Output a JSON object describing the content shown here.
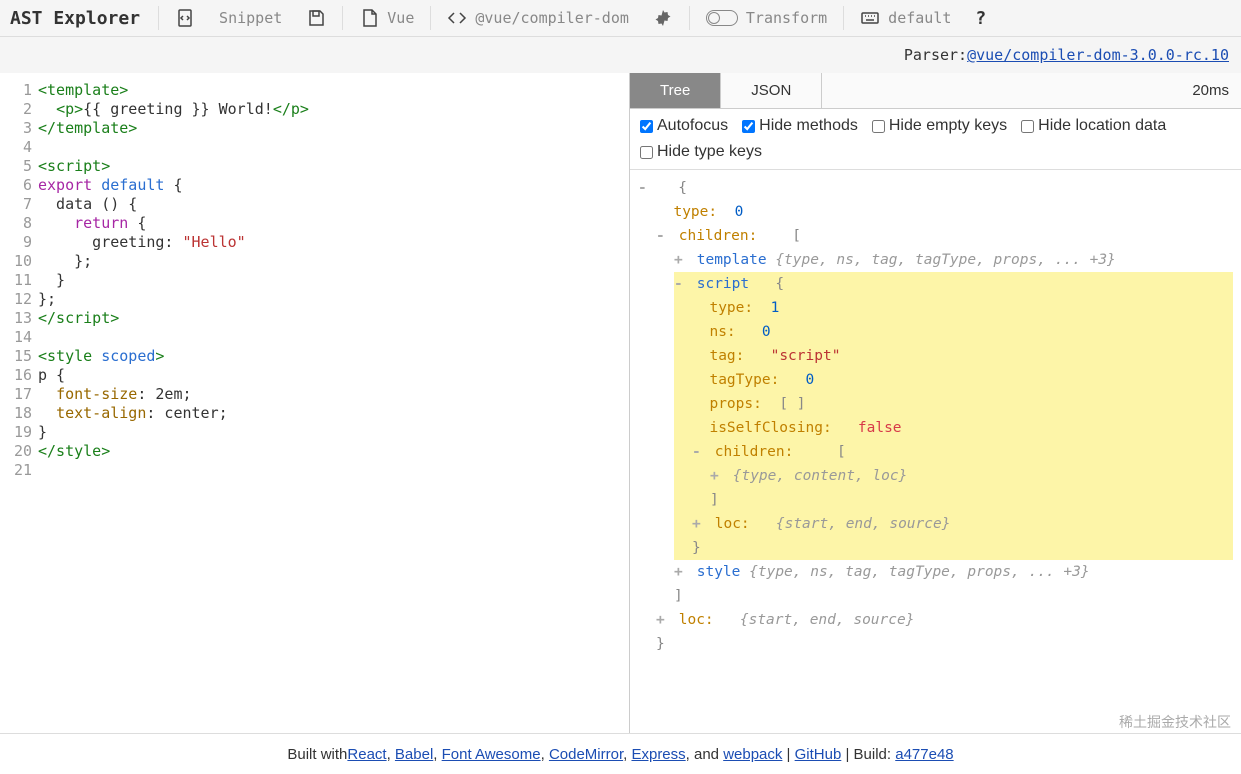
{
  "header": {
    "logo": "AST Explorer",
    "snippet": "Snippet",
    "lang": "Vue",
    "parser": "@vue/compiler-dom",
    "transform": "Transform",
    "keymap": "default",
    "help": "?"
  },
  "parser_bar": {
    "label": "Parser: ",
    "link": "@vue/compiler-dom-3.0.0-rc.10"
  },
  "editor": {
    "lines": [
      {
        "segs": [
          {
            "t": "<template>",
            "c": "tag"
          }
        ]
      },
      {
        "segs": [
          {
            "t": "  "
          },
          {
            "t": "<p>",
            "c": "tag"
          },
          {
            "t": "{{ greeting }}"
          },
          {
            "t": " World!"
          },
          {
            "t": "</p>",
            "c": "tag"
          }
        ]
      },
      {
        "segs": [
          {
            "t": "</template>",
            "c": "tag"
          }
        ]
      },
      {
        "segs": []
      },
      {
        "segs": [
          {
            "t": "<script>",
            "c": "tag"
          }
        ]
      },
      {
        "segs": [
          {
            "t": "export ",
            "c": "kw"
          },
          {
            "t": "default ",
            "c": "attr"
          },
          {
            "t": "{"
          }
        ]
      },
      {
        "segs": [
          {
            "t": "  data () {"
          }
        ]
      },
      {
        "segs": [
          {
            "t": "    "
          },
          {
            "t": "return ",
            "c": "kw"
          },
          {
            "t": "{"
          }
        ]
      },
      {
        "segs": [
          {
            "t": "      greeting: "
          },
          {
            "t": "\"Hello\"",
            "c": "str"
          }
        ]
      },
      {
        "segs": [
          {
            "t": "    };"
          }
        ]
      },
      {
        "segs": [
          {
            "t": "  }"
          }
        ]
      },
      {
        "segs": [
          {
            "t": "};"
          }
        ]
      },
      {
        "segs": [
          {
            "t": "</script>",
            "c": "tag"
          }
        ]
      },
      {
        "segs": []
      },
      {
        "segs": [
          {
            "t": "<style ",
            "c": "tag"
          },
          {
            "t": "scoped",
            "c": "attr"
          },
          {
            "t": ">",
            "c": "tag"
          }
        ]
      },
      {
        "segs": [
          {
            "t": "p {"
          }
        ]
      },
      {
        "segs": [
          {
            "t": "  "
          },
          {
            "t": "font-size",
            "c": "prop"
          },
          {
            "t": ": 2em;"
          }
        ]
      },
      {
        "segs": [
          {
            "t": "  "
          },
          {
            "t": "text-align",
            "c": "prop"
          },
          {
            "t": ": center;"
          }
        ]
      },
      {
        "segs": [
          {
            "t": "}"
          }
        ]
      },
      {
        "segs": [
          {
            "t": "</style>",
            "c": "tag"
          }
        ]
      },
      {
        "segs": []
      }
    ]
  },
  "tabs": {
    "tree": "Tree",
    "json": "JSON",
    "time": "20ms"
  },
  "options": {
    "autofocus": {
      "label": "Autofocus",
      "checked": true
    },
    "hide_methods": {
      "label": "Hide methods",
      "checked": true
    },
    "hide_empty_keys": {
      "label": "Hide empty keys",
      "checked": false
    },
    "hide_location": {
      "label": "Hide location data",
      "checked": false
    },
    "hide_type_keys": {
      "label": "Hide type keys",
      "checked": false
    }
  },
  "tree": {
    "root_type": {
      "key": "type:",
      "val": "0"
    },
    "children_key": "children:",
    "template": {
      "key": "template",
      "preview": "{type, ns, tag, tagType, props, ... +3}"
    },
    "script": {
      "key": "script",
      "type": {
        "k": "type:",
        "v": "1"
      },
      "ns": {
        "k": "ns:",
        "v": "0"
      },
      "tag": {
        "k": "tag:",
        "v": "\"script\""
      },
      "tagType": {
        "k": "tagType:",
        "v": "0"
      },
      "props": {
        "k": "props:",
        "v": "[ ]"
      },
      "isSelfClosing": {
        "k": "isSelfClosing:",
        "v": "false"
      },
      "children": {
        "k": "children:",
        "preview": "{type, content, loc}"
      },
      "loc": {
        "k": "loc:",
        "preview": "{start, end, source}"
      }
    },
    "style": {
      "key": "style",
      "preview": "{type, ns, tag, tagType, props, ... +3}"
    },
    "root_loc": {
      "k": "loc:",
      "preview": "{start, end, source}"
    }
  },
  "footer": {
    "prefix": "Built with ",
    "links": [
      "React",
      "Babel",
      "Font Awesome",
      "CodeMirror",
      "Express",
      "webpack",
      "GitHub"
    ],
    "and": ", and ",
    "sep": " | ",
    "build_label": " | Build: ",
    "build": "a477e48"
  },
  "watermark": "稀土掘金技术社区"
}
